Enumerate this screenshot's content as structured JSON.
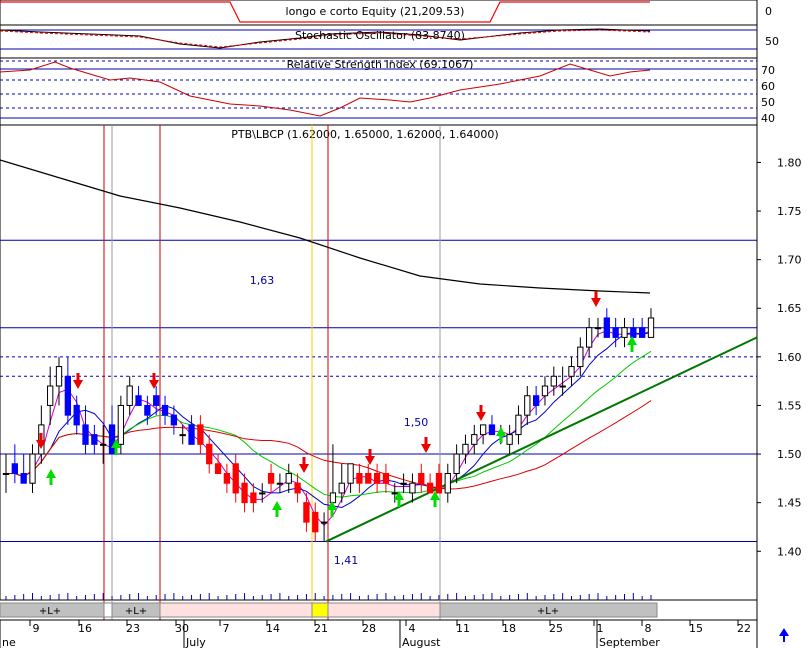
{
  "panels": {
    "equity": {
      "title": "longo e corto Equity (21,209.53)"
    },
    "stochastic": {
      "title": "Stochastic Oscillator (83.8740)",
      "ticks": [
        "50"
      ]
    },
    "rsi": {
      "title": "Relative Strength Index (69.1067)",
      "ticks": [
        "70",
        "60",
        "50",
        "40"
      ]
    },
    "price": {
      "title": "PTB\\LBCP (1.62000, 1.65000, 1.62000, 1.64000)"
    },
    "top_tick": "0"
  },
  "chart_data": {
    "type": "candlestick",
    "y_ticks": [
      "1.80",
      "1.75",
      "1.70",
      "1.65",
      "1.60",
      "1.55",
      "1.50",
      "1.45",
      "1.40"
    ],
    "ylim": [
      1.355,
      1.82
    ],
    "x_ticks": [
      "9",
      "16",
      "23",
      "30",
      "7",
      "14",
      "21",
      "28",
      "4",
      "11",
      "18",
      "25",
      "1",
      "8",
      "15",
      "22"
    ],
    "x_month_labels": [
      "ne",
      "July",
      "August",
      "September"
    ],
    "horizontal_levels": [
      1.72,
      1.63,
      1.6,
      1.58,
      1.5,
      1.41
    ],
    "level_labels": [
      {
        "text": "1,63",
        "value": 1.63
      },
      {
        "text": "1,50",
        "value": 1.5
      },
      {
        "text": "1,41",
        "value": 1.41
      }
    ],
    "trendline": {
      "from": [
        1.41
      ],
      "to": [
        1.62
      ]
    },
    "position_bar_labels": [
      "+L+",
      "+L+",
      "+L+"
    ],
    "candles": [
      {
        "o": 1.48,
        "h": 1.5,
        "l": 1.46,
        "c": 1.48
      },
      {
        "o": 1.49,
        "h": 1.51,
        "l": 1.47,
        "c": 1.48
      },
      {
        "o": 1.48,
        "h": 1.5,
        "l": 1.47,
        "c": 1.47
      },
      {
        "o": 1.47,
        "h": 1.51,
        "l": 1.46,
        "c": 1.5
      },
      {
        "o": 1.5,
        "h": 1.55,
        "l": 1.49,
        "c": 1.53
      },
      {
        "o": 1.55,
        "h": 1.59,
        "l": 1.53,
        "c": 1.57
      },
      {
        "o": 1.57,
        "h": 1.6,
        "l": 1.55,
        "c": 1.59
      },
      {
        "o": 1.58,
        "h": 1.6,
        "l": 1.53,
        "c": 1.54
      },
      {
        "o": 1.55,
        "h": 1.56,
        "l": 1.52,
        "c": 1.53
      },
      {
        "o": 1.53,
        "h": 1.55,
        "l": 1.5,
        "c": 1.51
      },
      {
        "o": 1.52,
        "h": 1.53,
        "l": 1.5,
        "c": 1.51
      },
      {
        "o": 1.51,
        "h": 1.53,
        "l": 1.49,
        "c": 1.51
      },
      {
        "o": 1.53,
        "h": 1.55,
        "l": 1.5,
        "c": 1.5
      },
      {
        "o": 1.51,
        "h": 1.56,
        "l": 1.5,
        "c": 1.55
      },
      {
        "o": 1.55,
        "h": 1.58,
        "l": 1.54,
        "c": 1.57
      },
      {
        "o": 1.56,
        "h": 1.57,
        "l": 1.55,
        "c": 1.55
      },
      {
        "o": 1.55,
        "h": 1.56,
        "l": 1.53,
        "c": 1.54
      },
      {
        "o": 1.56,
        "h": 1.57,
        "l": 1.54,
        "c": 1.55
      },
      {
        "o": 1.55,
        "h": 1.56,
        "l": 1.53,
        "c": 1.54
      },
      {
        "o": 1.54,
        "h": 1.55,
        "l": 1.52,
        "c": 1.53
      },
      {
        "o": 1.52,
        "h": 1.53,
        "l": 1.51,
        "c": 1.52
      },
      {
        "o": 1.53,
        "h": 1.54,
        "l": 1.51,
        "c": 1.51
      },
      {
        "o": 1.53,
        "h": 1.54,
        "l": 1.5,
        "c": 1.51
      },
      {
        "o": 1.51,
        "h": 1.52,
        "l": 1.48,
        "c": 1.49
      },
      {
        "o": 1.49,
        "h": 1.5,
        "l": 1.48,
        "c": 1.48
      },
      {
        "o": 1.48,
        "h": 1.49,
        "l": 1.46,
        "c": 1.47
      },
      {
        "o": 1.49,
        "h": 1.5,
        "l": 1.45,
        "c": 1.46
      },
      {
        "o": 1.47,
        "h": 1.48,
        "l": 1.44,
        "c": 1.45
      },
      {
        "o": 1.46,
        "h": 1.47,
        "l": 1.44,
        "c": 1.45
      },
      {
        "o": 1.46,
        "h": 1.47,
        "l": 1.45,
        "c": 1.46
      },
      {
        "o": 1.48,
        "h": 1.49,
        "l": 1.46,
        "c": 1.47
      },
      {
        "o": 1.47,
        "h": 1.48,
        "l": 1.46,
        "c": 1.47
      },
      {
        "o": 1.47,
        "h": 1.49,
        "l": 1.46,
        "c": 1.48
      },
      {
        "o": 1.47,
        "h": 1.48,
        "l": 1.45,
        "c": 1.46
      },
      {
        "o": 1.45,
        "h": 1.46,
        "l": 1.42,
        "c": 1.43
      },
      {
        "o": 1.44,
        "h": 1.45,
        "l": 1.41,
        "c": 1.42
      },
      {
        "o": 1.43,
        "h": 1.44,
        "l": 1.41,
        "c": 1.43
      },
      {
        "o": 1.45,
        "h": 1.51,
        "l": 1.44,
        "c": 1.46
      },
      {
        "o": 1.46,
        "h": 1.49,
        "l": 1.45,
        "c": 1.47
      },
      {
        "o": 1.47,
        "h": 1.49,
        "l": 1.46,
        "c": 1.49
      },
      {
        "o": 1.48,
        "h": 1.49,
        "l": 1.46,
        "c": 1.47
      },
      {
        "o": 1.48,
        "h": 1.49,
        "l": 1.47,
        "c": 1.47
      },
      {
        "o": 1.48,
        "h": 1.49,
        "l": 1.46,
        "c": 1.47
      },
      {
        "o": 1.48,
        "h": 1.49,
        "l": 1.46,
        "c": 1.47
      },
      {
        "o": 1.46,
        "h": 1.47,
        "l": 1.45,
        "c": 1.46
      },
      {
        "o": 1.47,
        "h": 1.48,
        "l": 1.46,
        "c": 1.47
      },
      {
        "o": 1.46,
        "h": 1.48,
        "l": 1.45,
        "c": 1.47
      },
      {
        "o": 1.48,
        "h": 1.49,
        "l": 1.46,
        "c": 1.47
      },
      {
        "o": 1.47,
        "h": 1.48,
        "l": 1.46,
        "c": 1.46
      },
      {
        "o": 1.48,
        "h": 1.49,
        "l": 1.46,
        "c": 1.46
      },
      {
        "o": 1.46,
        "h": 1.49,
        "l": 1.45,
        "c": 1.48
      },
      {
        "o": 1.48,
        "h": 1.51,
        "l": 1.47,
        "c": 1.5
      },
      {
        "o": 1.5,
        "h": 1.52,
        "l": 1.49,
        "c": 1.51
      },
      {
        "o": 1.51,
        "h": 1.53,
        "l": 1.5,
        "c": 1.52
      },
      {
        "o": 1.52,
        "h": 1.53,
        "l": 1.51,
        "c": 1.53
      },
      {
        "o": 1.53,
        "h": 1.54,
        "l": 1.52,
        "c": 1.52
      },
      {
        "o": 1.52,
        "h": 1.53,
        "l": 1.51,
        "c": 1.52
      },
      {
        "o": 1.51,
        "h": 1.53,
        "l": 1.5,
        "c": 1.52
      },
      {
        "o": 1.52,
        "h": 1.55,
        "l": 1.51,
        "c": 1.54
      },
      {
        "o": 1.54,
        "h": 1.57,
        "l": 1.53,
        "c": 1.56
      },
      {
        "o": 1.56,
        "h": 1.57,
        "l": 1.54,
        "c": 1.55
      },
      {
        "o": 1.56,
        "h": 1.58,
        "l": 1.55,
        "c": 1.57
      },
      {
        "o": 1.57,
        "h": 1.59,
        "l": 1.56,
        "c": 1.58
      },
      {
        "o": 1.57,
        "h": 1.59,
        "l": 1.56,
        "c": 1.57
      },
      {
        "o": 1.58,
        "h": 1.6,
        "l": 1.57,
        "c": 1.59
      },
      {
        "o": 1.59,
        "h": 1.62,
        "l": 1.58,
        "c": 1.61
      },
      {
        "o": 1.61,
        "h": 1.64,
        "l": 1.6,
        "c": 1.63
      },
      {
        "o": 1.63,
        "h": 1.64,
        "l": 1.62,
        "c": 1.63
      },
      {
        "o": 1.64,
        "h": 1.65,
        "l": 1.62,
        "c": 1.62
      },
      {
        "o": 1.63,
        "h": 1.64,
        "l": 1.61,
        "c": 1.62
      },
      {
        "o": 1.62,
        "h": 1.64,
        "l": 1.61,
        "c": 1.63
      },
      {
        "o": 1.63,
        "h": 1.64,
        "l": 1.62,
        "c": 1.62
      },
      {
        "o": 1.63,
        "h": 1.64,
        "l": 1.62,
        "c": 1.62
      },
      {
        "o": 1.62,
        "h": 1.65,
        "l": 1.62,
        "c": 1.64
      }
    ]
  },
  "colors": {
    "up": "#ffffff",
    "down_blue": "#0000ff",
    "down_red": "#ff0000",
    "level": "#0000aa",
    "sma_long": "#000000",
    "ma_blue": "#0000cc",
    "ma_magenta": "#cc00cc",
    "ma_green": "#00cc00",
    "ma_red": "#dd0000",
    "trend": "#007700",
    "arrow_down": "#ee0000",
    "arrow_up": "#00dd00"
  }
}
